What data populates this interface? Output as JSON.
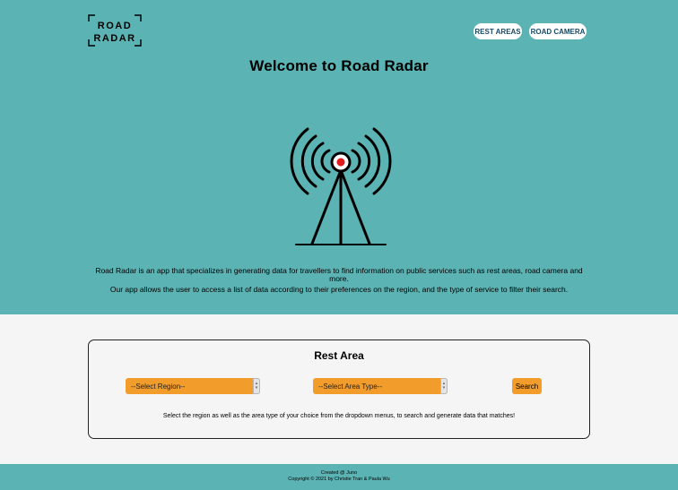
{
  "header": {
    "logo_line1": "ROAD",
    "logo_line2": "RADAR",
    "nav": {
      "rest_areas": "REST AREAS",
      "road_camera": "ROAD CAMERA"
    }
  },
  "hero": {
    "title": "Welcome to Road Radar",
    "icon": "radio-tower-icon",
    "about_line1": "Road Radar is an app that specializes in generating data for travellers to find information on public services such as rest areas, road camera and more.",
    "about_line2": "Our app allows the user to access a list of data according to their preferences on the region, and the type of service to filter their search."
  },
  "panel": {
    "title": "Rest Area",
    "region_select": "--Select Region--",
    "area_type_select": "--Select Area Type--",
    "search_label": "Search",
    "hint": "Select the region as well as the area type of your choice from the dropdown menus, to search and generate data that matches!"
  },
  "footer": {
    "line1": "Created @ Juno",
    "line2": "Copyright © 2021 by Christie Tran & Paula Wu"
  },
  "colors": {
    "teal": "#5cb3b4",
    "orange": "#f29c2b",
    "signal_red": "#e11b1b",
    "nav_text": "#1a4a66"
  }
}
